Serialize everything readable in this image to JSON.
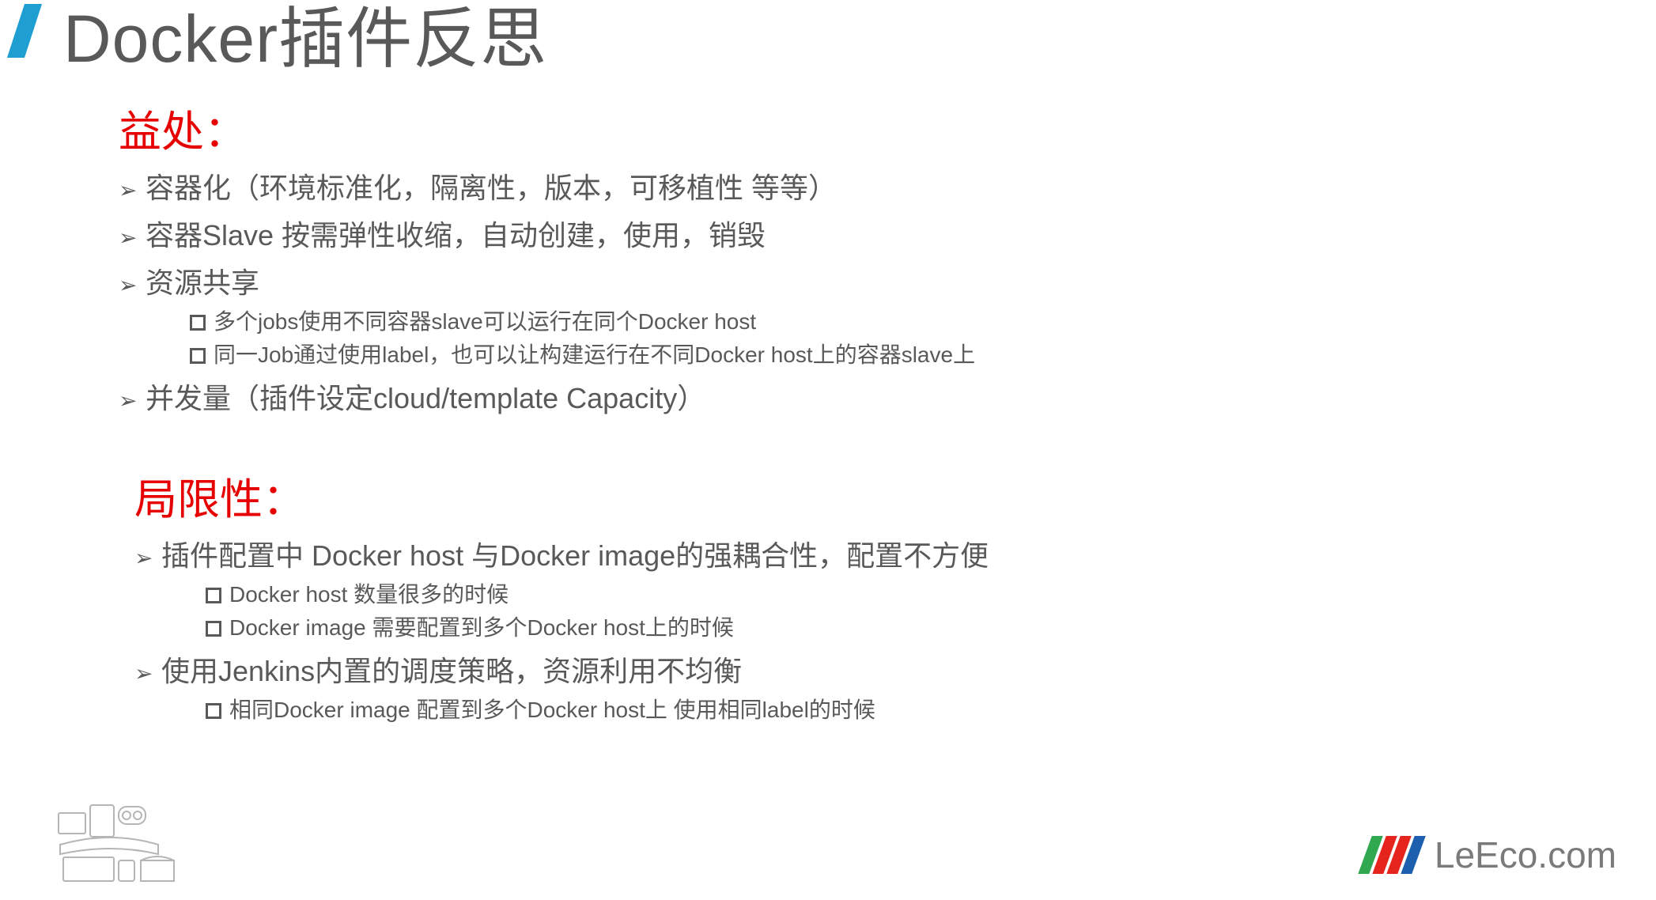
{
  "title": "Docker插件反思",
  "benefits": {
    "heading": "益处：",
    "items": [
      {
        "text": "容器化（环境标准化，隔离性，版本，可移植性 等等）",
        "sub": []
      },
      {
        "text": "容器Slave 按需弹性收缩，自动创建，使用，销毁",
        "sub": []
      },
      {
        "text": "资源共享",
        "sub": [
          "多个jobs使用不同容器slave可以运行在同个Docker host",
          "同一Job通过使用label，也可以让构建运行在不同Docker host上的容器slave上"
        ]
      },
      {
        "text": "并发量（插件设定cloud/template Capacity）",
        "sub": []
      }
    ]
  },
  "limits": {
    "heading": "局限性：",
    "items": [
      {
        "text": "插件配置中 Docker host 与Docker image的强耦合性，配置不方便",
        "sub": [
          "Docker host 数量很多的时候",
          "Docker image 需要配置到多个Docker host上的时候"
        ]
      },
      {
        "text": "使用Jenkins内置的调度策略，资源利用不均衡",
        "sub": [
          "相同Docker image 配置到多个Docker host上 使用相同label的时候"
        ]
      }
    ]
  },
  "footer_logo_text": "LeEco.com"
}
